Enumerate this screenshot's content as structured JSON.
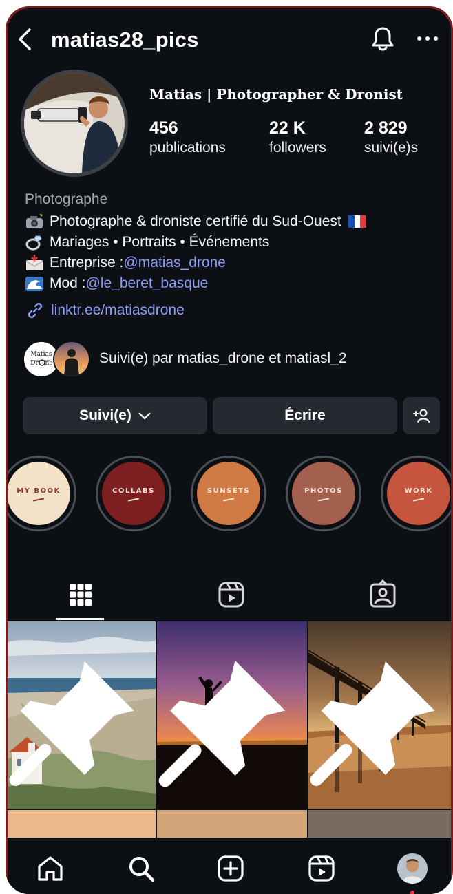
{
  "header": {
    "username": "matias28_pics",
    "back_icon": "chevron-left-icon",
    "bell_icon": "bell-icon",
    "more_icon": "more-horizontal-icon"
  },
  "profile": {
    "display_name": "Matias | Photographer & Dronist",
    "stats": [
      {
        "value": "456",
        "label": "publications"
      },
      {
        "value": "22 K",
        "label": "followers"
      },
      {
        "value": "2 829",
        "label": "suivi(e)s"
      }
    ],
    "category": "Photographe",
    "bio": [
      {
        "icon": "camera-flash-emoji",
        "text": "Photographe & droniste certifié du Sud-Ouest",
        "trail_icon": "france-flag-emoji"
      },
      {
        "icon": "ring-emoji",
        "text": "Mariages • Portraits • Événements"
      },
      {
        "icon": "envelope-emoji",
        "text": "Entreprise : ",
        "mention": "@matias_drone"
      },
      {
        "icon": "wave-emoji",
        "text": "Mod : ",
        "mention": "@le_beret_basque"
      }
    ],
    "link": "linktr.ee/matiasdrone",
    "followed_by": "Suivi(e) par matias_drone et matiasl_2",
    "followed_by_avatar_text": [
      "Matias",
      "Dr",
      "ne"
    ]
  },
  "actions": {
    "following_label": "Suivi(e)",
    "message_label": "Écrire",
    "add_user_icon": "add-user-icon"
  },
  "highlights": [
    {
      "label": "MY BOOK",
      "bg": "#f3e1c8",
      "fg": "#8a3a2a"
    },
    {
      "label": "COLLABS",
      "bg": "#7e1f22",
      "fg": "#f2e3d3"
    },
    {
      "label": "SUNSETS",
      "bg": "#d07a45",
      "fg": "#fbe9d8"
    },
    {
      "label": "PHOTOS",
      "bg": "#a4604f",
      "fg": "#f6e4d8"
    },
    {
      "label": "WORK",
      "bg": "#c5553c",
      "fg": "#fbe6da"
    }
  ],
  "tabs": [
    "grid-icon",
    "reels-icon",
    "tagged-icon"
  ],
  "nav": [
    "home-icon",
    "search-icon",
    "create-icon",
    "reels-icon",
    "profile-avatar"
  ],
  "colors": {
    "background": "#0c1014",
    "link": "#8e9df7",
    "button": "#262a30",
    "frame": "#7b1d20"
  }
}
